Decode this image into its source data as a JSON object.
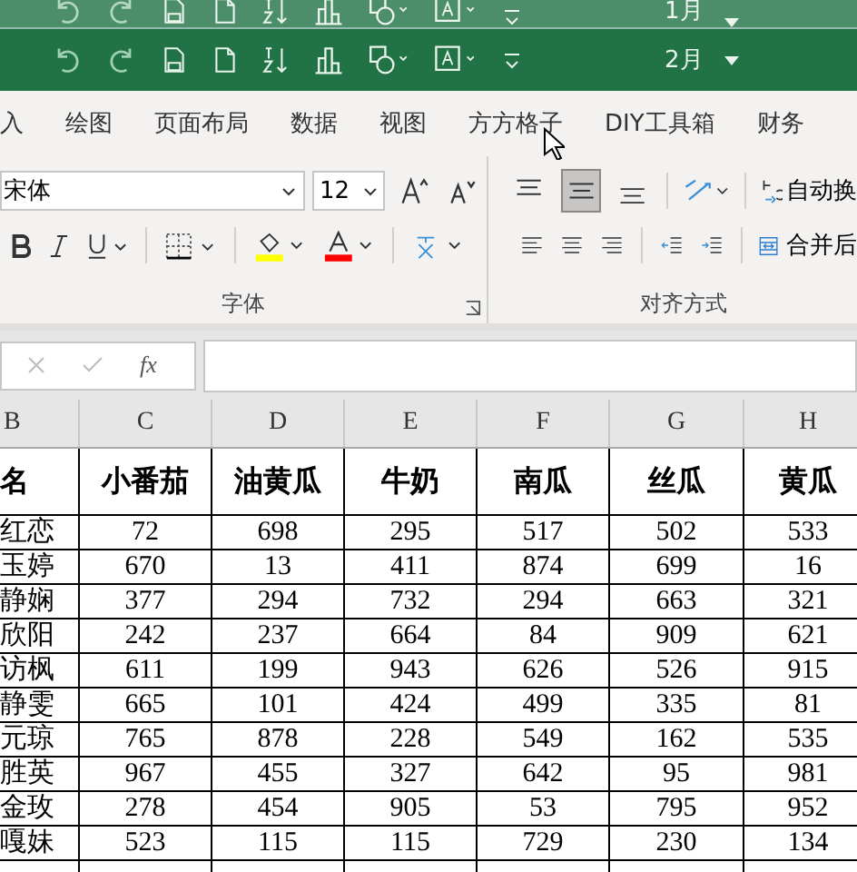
{
  "title_bars": [
    {
      "title": "1月"
    },
    {
      "title": "2月"
    }
  ],
  "ribbon_tabs": [
    {
      "label": "入"
    },
    {
      "label": "绘图"
    },
    {
      "label": "页面布局"
    },
    {
      "label": "数据"
    },
    {
      "label": "视图"
    },
    {
      "label": "方方格子"
    },
    {
      "label": "DIY工具箱"
    },
    {
      "label": "财务"
    }
  ],
  "font_group": {
    "font_name": "宋体",
    "font_size": "12",
    "label": "字体"
  },
  "alignment_group": {
    "label": "对齐方式",
    "vertical_align": [
      {
        "selected": false
      },
      {
        "selected": true
      },
      {
        "selected": false
      }
    ],
    "wrap_text": "自动换",
    "merge": "合并后"
  },
  "formula_bar": {
    "fx": "fx"
  },
  "columns": [
    "B",
    "C",
    "D",
    "E",
    "F",
    "G",
    "H"
  ],
  "header_row": [
    "名",
    "小番茄",
    "油黄瓜",
    "牛奶",
    "南瓜",
    "丝瓜",
    "黄瓜"
  ],
  "rows": [
    [
      "红恋",
      "72",
      "698",
      "295",
      "517",
      "502",
      "533"
    ],
    [
      "玉婷",
      "670",
      "13",
      "411",
      "874",
      "699",
      "16"
    ],
    [
      "静娴",
      "377",
      "294",
      "732",
      "294",
      "663",
      "321"
    ],
    [
      "欣阳",
      "242",
      "237",
      "664",
      "84",
      "909",
      "621"
    ],
    [
      "访枫",
      "611",
      "199",
      "943",
      "626",
      "526",
      "915"
    ],
    [
      "静雯",
      "665",
      "101",
      "424",
      "499",
      "335",
      "81"
    ],
    [
      "元琼",
      "765",
      "878",
      "228",
      "549",
      "162",
      "535"
    ],
    [
      "胜英",
      "967",
      "455",
      "327",
      "642",
      "95",
      "981"
    ],
    [
      "金玫",
      "278",
      "454",
      "905",
      "53",
      "795",
      "952"
    ],
    [
      "嘎妹",
      "523",
      "115",
      "115",
      "729",
      "230",
      "134"
    ]
  ]
}
